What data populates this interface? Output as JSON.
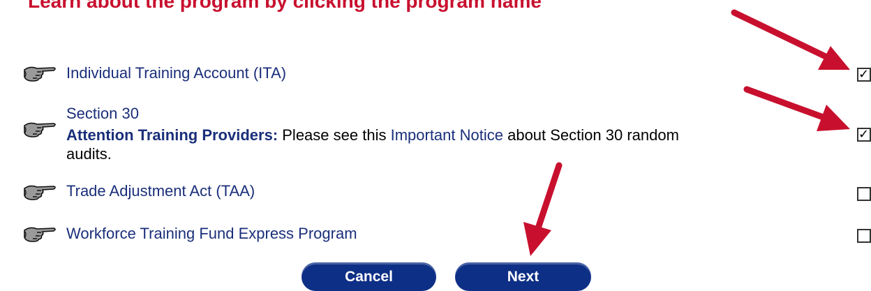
{
  "page": {
    "heading": "Learn about the program by clicking the program name"
  },
  "programs": [
    {
      "name": "Individual Training Account (ITA)",
      "icon": "pointing-hand-icon",
      "checked": true
    },
    {
      "name": "Section 30",
      "icon": "pointing-hand-icon",
      "checked": true,
      "notice": {
        "label": "Attention Training Providers:",
        "before_link": " Please see this ",
        "link_text": "Important Notice",
        "after_link": " about Section 30 random audits."
      }
    },
    {
      "name": "Trade Adjustment Act (TAA)",
      "icon": "pointing-hand-icon",
      "checked": false
    },
    {
      "name": "Workforce Training Fund Express Program",
      "icon": "pointing-hand-icon",
      "checked": false
    }
  ],
  "checkbox_marks": {
    "checked": "✓",
    "unchecked": ""
  },
  "buttons": {
    "cancel": "Cancel",
    "next": "Next"
  },
  "colors": {
    "heading": "#c8102e",
    "link": "#1a2f7a",
    "button": "#0e2f86",
    "arrow": "#c8102e"
  }
}
